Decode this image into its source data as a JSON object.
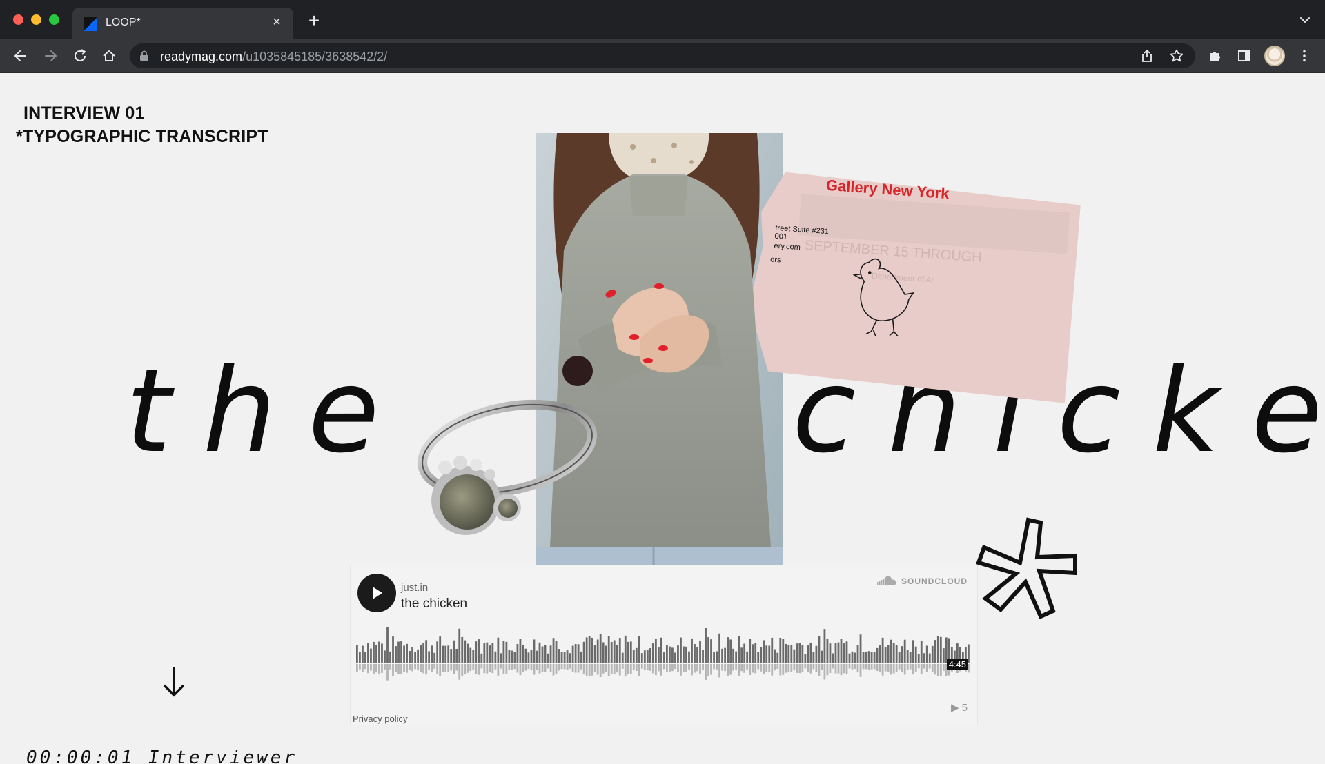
{
  "browser": {
    "tab_title": "LOOP*",
    "url_host": "readymag.com",
    "url_path": "/u1035845185/3638542/2/",
    "tab_close_glyph": "×",
    "new_tab_glyph": "+"
  },
  "page": {
    "heading_line1": "INTERVIEW 01",
    "heading_line2": "*TYPOGRAPHIC TRANSCRIPT",
    "word_left": "the",
    "word_right": "chicken",
    "card_text": {
      "gallery": "Gallery New York",
      "line1": "treet Suite #231",
      "line2": "001",
      "line3": "ery.com",
      "line4": "ors",
      "ghost1": "SEPTEMBER 15 THROUGH",
      "ghost2": "Department of Ar"
    },
    "transcript_peek": "00:00:01 Interviewer"
  },
  "player": {
    "user": "just.in",
    "track": "the chicken",
    "brand": "SOUNDCLOUD",
    "duration": "4:45",
    "plays": "5",
    "privacy": "Privacy policy"
  },
  "colors": {
    "page_bg": "#f1f1f1",
    "chrome_dark": "#202124",
    "chrome_toolbar": "#35363a",
    "accent_red": "#d7262a"
  }
}
